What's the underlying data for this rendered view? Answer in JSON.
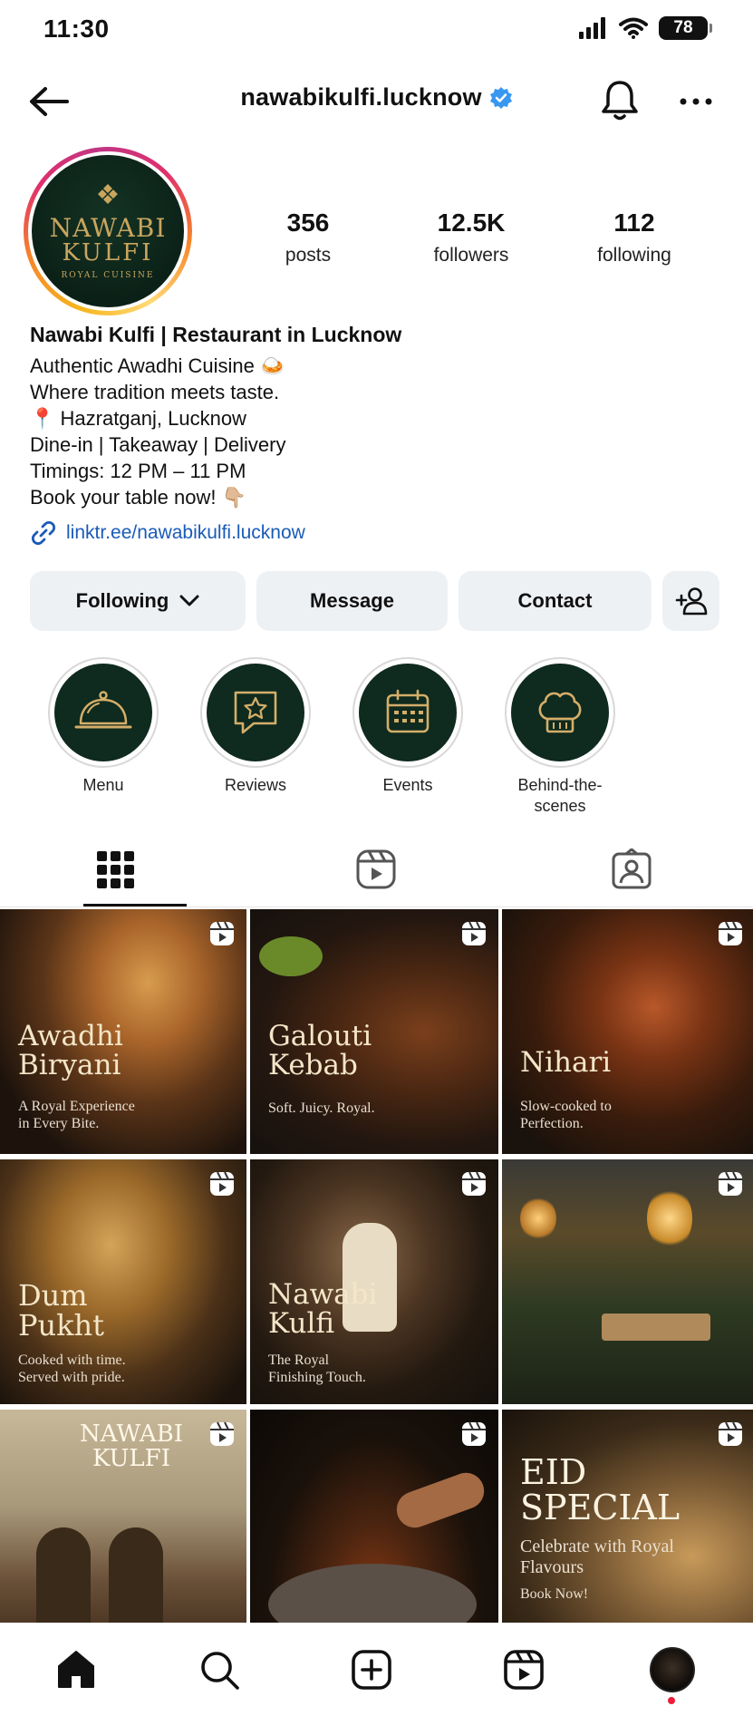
{
  "status_bar": {
    "time": "11:30",
    "battery": "78"
  },
  "header": {
    "username": "nawabikulfi.lucknow"
  },
  "avatar": {
    "logo_line1": "NAWABI",
    "logo_line2": "KULFI",
    "logo_sub": "ROYAL CUISINE"
  },
  "stats": [
    {
      "value": "356",
      "label": "posts"
    },
    {
      "value": "12.5K",
      "label": "followers"
    },
    {
      "value": "112",
      "label": "following"
    }
  ],
  "bio": {
    "name": "Nawabi Kulfi | Restaurant in Lucknow",
    "lines": [
      "Authentic Awadhi Cuisine 🍛",
      "Where tradition meets taste.",
      "📍 Hazratganj, Lucknow",
      "Dine-in | Takeaway | Delivery",
      "Timings: 12 PM – 11 PM",
      "Book your table now! 👇🏼"
    ],
    "link": "linktr.ee/nawabikulfi.lucknow"
  },
  "actions": {
    "following": "Following",
    "message": "Message",
    "contact": "Contact"
  },
  "highlights": [
    {
      "label": "Menu",
      "icon": "cloche-icon"
    },
    {
      "label": "Reviews",
      "icon": "review-star-icon"
    },
    {
      "label": "Events",
      "icon": "calendar-icon"
    },
    {
      "label": "Behind-the-scenes",
      "icon": "chef-hat-icon"
    }
  ],
  "tabs": [
    {
      "name": "grid",
      "icon": "grid-icon",
      "active": true
    },
    {
      "name": "reels",
      "icon": "reels-icon",
      "active": false
    },
    {
      "name": "tagged",
      "icon": "tagged-icon",
      "active": false
    }
  ],
  "posts": [
    {
      "title": "Awadhi Biryani",
      "subtitle": "A Royal Experience in Every Bite."
    },
    {
      "title": "Galouti Kebab",
      "subtitle": "Soft. Juicy. Royal."
    },
    {
      "title": "Nihari",
      "subtitle": "Slow-cooked to Perfection."
    },
    {
      "title": "Dum Pukht",
      "subtitle": "Cooked with time. Served with pride."
    },
    {
      "title": "Nawabi Kulfi",
      "subtitle": "The Royal Finishing Touch."
    },
    {
      "title": "",
      "subtitle": ""
    },
    {
      "title": "NAWABI KULFI",
      "subtitle": ""
    },
    {
      "title": "",
      "subtitle": ""
    },
    {
      "title": "EID SPECIAL",
      "subtitle": "Celebrate with Royal Flavours",
      "cta": "Book Now!"
    }
  ],
  "nav": [
    "home-icon",
    "search-icon",
    "create-icon",
    "reels-icon",
    "profile-avatar"
  ],
  "colors": {
    "verified": "#3897f0",
    "link": "#1a5bb8",
    "highlight_bg": "#0f2a1e",
    "gold": "#c9a55e",
    "notification": "#ed1c3c"
  }
}
